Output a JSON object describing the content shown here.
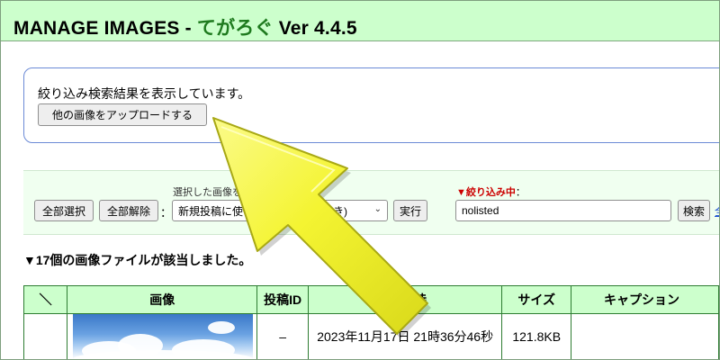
{
  "header": {
    "title_prefix": "MANAGE IMAGES - ",
    "app_name": "てがろぐ",
    "version": " Ver 4.4.5"
  },
  "notice": {
    "message": "絞り込み検索結果を表示しています。",
    "upload_button": "他の画像をアップロードする"
  },
  "toolbar": {
    "select_all": "全部選択",
    "deselect_all": "全部解除",
    "separator": "：",
    "selected_images_label": "選択した画像を...",
    "action_select": "新規投稿に使う(キャプション付き)",
    "execute": "実行",
    "filter_label": "▼絞り込み中",
    "filter_colon": "：",
    "filter_value": "nolisted",
    "search_button": "検索",
    "search_link": "全"
  },
  "results": {
    "count_message": "▼17個の画像ファイルが該当しました。"
  },
  "table": {
    "headers": [
      "＼",
      "画像",
      "投稿ID",
      "UP日時",
      "サイズ",
      "キャプション"
    ],
    "rows": [
      {
        "post_id": "–",
        "uploaded": "2023年11月17日 21時36分46秒",
        "size": "121.8KB",
        "caption": ""
      }
    ]
  },
  "colors": {
    "header_bg": "#ccffcc",
    "app_name": "#1e7a1e",
    "filter_label": "#cc0000",
    "arrow": "#f2f23a"
  }
}
